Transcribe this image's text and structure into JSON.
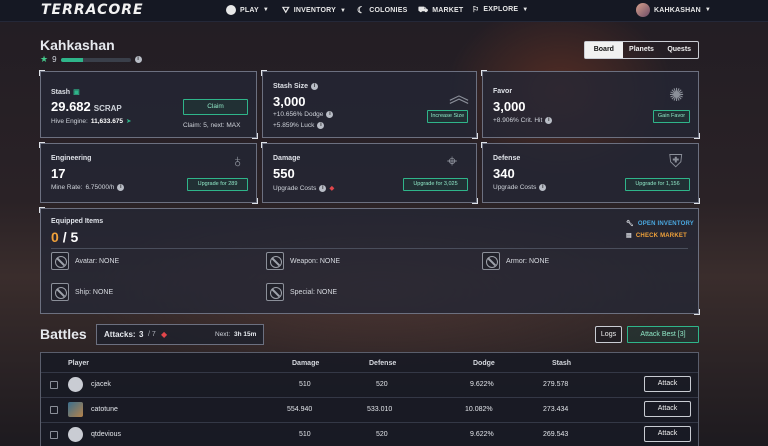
{
  "nav": {
    "logo": "TERRACORE",
    "items": [
      {
        "label": "PLAY",
        "icon": "play-icon"
      },
      {
        "label": "INVENTORY",
        "icon": "inventory-icon"
      },
      {
        "label": "COLONIES",
        "icon": "colonies-icon"
      },
      {
        "label": "MARKET",
        "icon": "market-icon"
      },
      {
        "label": "EXPLORE",
        "icon": "explore-icon"
      }
    ],
    "user": "KAHKASHAN"
  },
  "profile": {
    "name": "Kahkashan",
    "level": "9",
    "xp_fraction": 0.32
  },
  "tabs": [
    "Board",
    "Planets",
    "Quests"
  ],
  "stash": {
    "title": "Stash",
    "value": "29.682",
    "unit": "SCRAP",
    "hive_label": "Hive Engine:",
    "hive_value": "11,633.675",
    "claim_button": "Claim",
    "claim_info": "Claim: 5, next: MAX"
  },
  "stash_size": {
    "title": "Stash Size",
    "value": "3,000",
    "dodge": "+10.656% Dodge",
    "luck": "+5.859% Luck",
    "button": "Increase Size"
  },
  "favor": {
    "title": "Favor",
    "value": "3,000",
    "crit": "+8.906% Crit. Hit",
    "button": "Gain Favor"
  },
  "engineering": {
    "title": "Engineering",
    "value": "17",
    "rate_label": "Mine Rate:",
    "rate": "6.75000/h",
    "button": "Upgrade for 289"
  },
  "damage": {
    "title": "Damage",
    "value": "550",
    "costs": "Upgrade Costs",
    "button": "Upgrade for 3,025"
  },
  "defense": {
    "title": "Defense",
    "value": "340",
    "costs": "Upgrade Costs",
    "button": "Upgrade for 1,156"
  },
  "equipped": {
    "title": "Equipped Items",
    "count": "0",
    "total": "/ 5",
    "open_inventory": "OPEN INVENTORY",
    "check_market": "CHECK MARKET",
    "slots": [
      "Avatar: NONE",
      "Weapon: NONE",
      "Armor: NONE",
      "Ship: NONE",
      "Special: NONE"
    ]
  },
  "battles": {
    "title": "Battles",
    "attacks_label": "Attacks:",
    "attacks_value": "3",
    "attacks_max": "/ 7",
    "next_label": "Next:",
    "next_value": "3h 15m",
    "logs_button": "Logs",
    "attack_best_button": "Attack Best [3]",
    "columns": [
      "Player",
      "Damage",
      "Defense",
      "Dodge",
      "Stash"
    ],
    "rows": [
      {
        "player": "cjacek",
        "damage": "510",
        "defense": "520",
        "dodge": "9.622%",
        "stash": "279.578",
        "action": "Attack"
      },
      {
        "player": "catotune",
        "damage": "554.940",
        "defense": "533.010",
        "dodge": "10.082%",
        "stash": "273.434",
        "action": "Attack"
      },
      {
        "player": "qtdevious",
        "damage": "510",
        "defense": "520",
        "dodge": "9.622%",
        "stash": "269.543",
        "action": "Attack"
      }
    ]
  },
  "colors": {
    "accent": "#2fb58a",
    "warning": "#f0a13a",
    "danger": "#e2464b"
  }
}
